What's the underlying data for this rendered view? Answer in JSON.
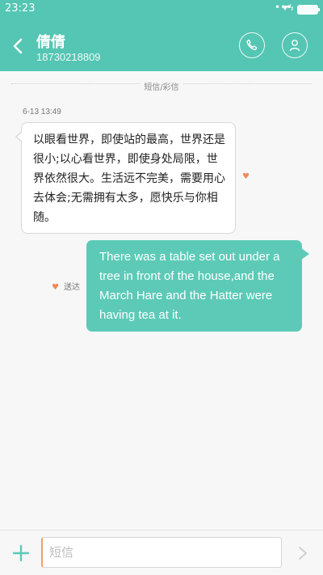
{
  "status_bar": {
    "time": "23:23",
    "dots": "•••",
    "bolt": "ϟ",
    "accent": "#54c6b3"
  },
  "header": {
    "contact_name": "倩倩",
    "contact_number": "18730218809",
    "back_icon": "chevron-left-icon",
    "call_icon": "phone-icon",
    "profile_icon": "person-icon"
  },
  "conversation": {
    "divider_label": "短信/彩信",
    "timestamp": "6-13 13:49",
    "incoming": {
      "text": "以眼看世界，即使站的最高，世界还是很小;以心看世界，即使身处局限，世界依然很大。生活远不完美，需要用心去体会;无需拥有太多，愿快乐与你相随。",
      "heart": "♥"
    },
    "outgoing": {
      "text": "There was a table set out under a tree in front of the house,and the March Hare and the Hatter were having tea at it.",
      "status": "送达",
      "heart": "♥"
    }
  },
  "composer": {
    "placeholder": "短信",
    "value": "",
    "plus_icon": "plus-icon",
    "send_icon": "send-chevron-icon"
  }
}
